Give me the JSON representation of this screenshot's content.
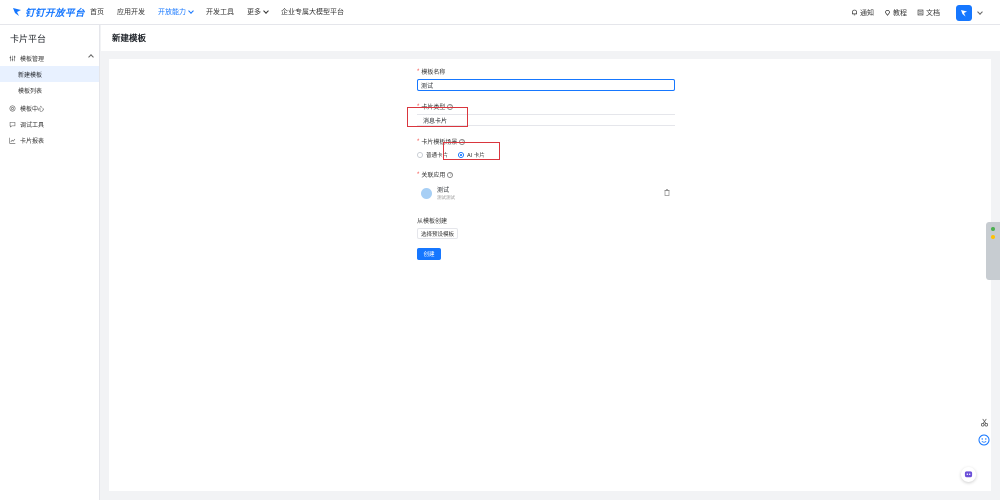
{
  "brand": {
    "name": "钉钉开放平台",
    "color": "#1677ff"
  },
  "nav": {
    "items": [
      {
        "label": "首页",
        "active": false,
        "dropdown": false
      },
      {
        "label": "应用开发",
        "active": false,
        "dropdown": false
      },
      {
        "label": "开放能力",
        "active": true,
        "dropdown": true
      },
      {
        "label": "开发工具",
        "active": false,
        "dropdown": false
      },
      {
        "label": "更多",
        "active": false,
        "dropdown": true
      },
      {
        "label": "企业专属大模型平台",
        "active": false,
        "dropdown": false
      }
    ],
    "right": {
      "notify": "通知",
      "tutorial": "教程",
      "docs": "文档"
    }
  },
  "sidebar": {
    "title": "卡片平台",
    "template_mgmt": "模板管理",
    "sub_new": "新建模板",
    "sub_list": "模板列表",
    "template_center": "模板中心",
    "debug_tools": "调试工具",
    "card_report": "卡片报表"
  },
  "page": {
    "title": "新建模板"
  },
  "form": {
    "name_label": "模板名称",
    "name_value": "测试",
    "type_label": "卡片类型",
    "type_value": "消息卡片",
    "scene_label": "卡片模板场景",
    "scene_options": [
      "普通卡片",
      "AI 卡片"
    ],
    "scene_selected": "AI 卡片",
    "app_label": "关联应用",
    "app_name": "测试",
    "app_desc": "测试测试",
    "from_template_label": "从模板创建",
    "choose_preset": "选择预设模板",
    "create_button": "创建"
  },
  "colors": {
    "accent": "#1677ff",
    "highlight": "#d9363e",
    "required": "#f54a45"
  }
}
